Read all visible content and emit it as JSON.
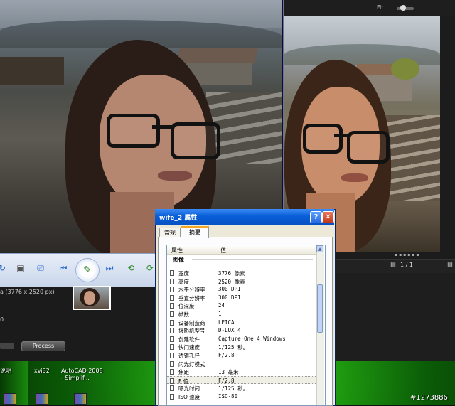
{
  "viewer": {
    "fit_label": "Fit",
    "image_size": "a (3776 x 2520 px)",
    "side_value": "0",
    "process_label": "Process",
    "counter": "1 / 1"
  },
  "dialog": {
    "title": "wife_2 属性",
    "help_glyph": "?",
    "close_glyph": "✕",
    "tabs": [
      {
        "label": "常规"
      },
      {
        "label": "摘要"
      }
    ],
    "columns": {
      "property": "属性",
      "value": "值"
    },
    "group": "图像",
    "rows": [
      {
        "name": "宽度",
        "value": "3776 像素"
      },
      {
        "name": "高度",
        "value": "2520 像素"
      },
      {
        "name": "水平分辨率",
        "value": "300 DPI"
      },
      {
        "name": "垂直分辨率",
        "value": "300 DPI"
      },
      {
        "name": "位深度",
        "value": "24"
      },
      {
        "name": "帧数",
        "value": "1"
      },
      {
        "name": "设备制造商",
        "value": "LEICA"
      },
      {
        "name": "摄影机型号",
        "value": "D-LUX 4"
      },
      {
        "name": "创建软件",
        "value": "Capture One 4 Windows"
      },
      {
        "name": "快门速度",
        "value": "1/125 秒。"
      },
      {
        "name": "透镜孔径",
        "value": "F/2.8"
      },
      {
        "name": "闪光灯模式",
        "value": ""
      },
      {
        "name": "焦距",
        "value": "13 毫米"
      },
      {
        "name": "F 值",
        "value": "F/2.8"
      },
      {
        "name": "曝光时间",
        "value": "1/125 秒。"
      },
      {
        "name": "ISO 速度",
        "value": "ISO-80"
      }
    ]
  },
  "desktop": {
    "icons": [
      {
        "label": "说明"
      },
      {
        "label": "xvi32"
      },
      {
        "label": "AutoCAD 2008 - Simplif..."
      }
    ],
    "watermark": "#1273886"
  }
}
